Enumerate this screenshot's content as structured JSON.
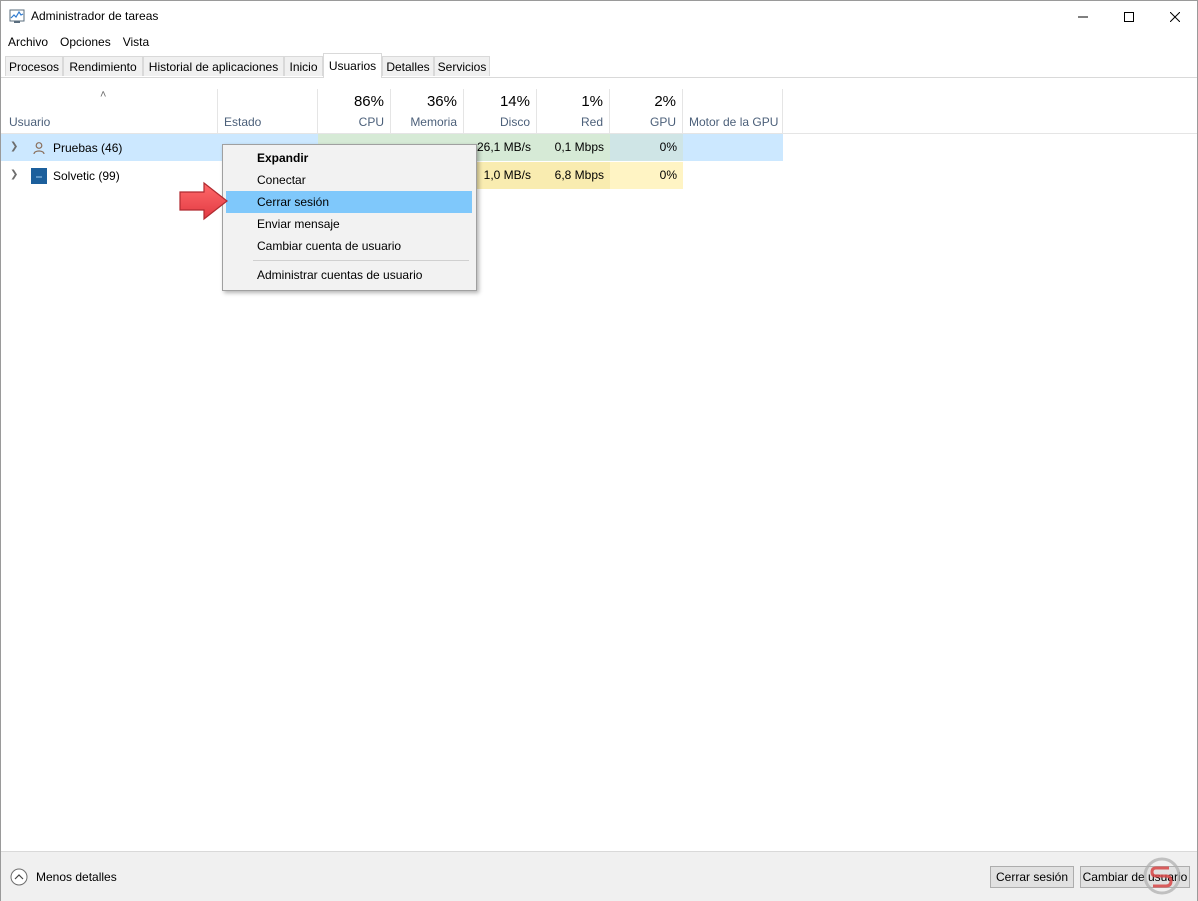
{
  "window": {
    "title": "Administrador de tareas"
  },
  "menu": [
    "Archivo",
    "Opciones",
    "Vista"
  ],
  "tabs": [
    "Procesos",
    "Rendimiento",
    "Historial de aplicaciones",
    "Inicio",
    "Usuarios",
    "Detalles",
    "Servicios"
  ],
  "active_tab": "Usuarios",
  "columns": {
    "usuario": "Usuario",
    "estado": "Estado",
    "cpu": {
      "pct": "86%",
      "label": "CPU"
    },
    "memoria": {
      "pct": "36%",
      "label": "Memoria"
    },
    "disco": {
      "pct": "14%",
      "label": "Disco"
    },
    "red": {
      "pct": "1%",
      "label": "Red"
    },
    "gpu": {
      "pct": "2%",
      "label": "GPU"
    },
    "motor_gpu": "Motor de la GPU"
  },
  "rows": [
    {
      "name": "Pruebas (46)",
      "disco": "26,1 MB/s",
      "red": "0,1 Mbps",
      "gpu": "0%"
    },
    {
      "name": "Solvetic (99)",
      "disco": "1,0 MB/s",
      "red": "6,8 Mbps",
      "gpu": "0%"
    }
  ],
  "context_menu": {
    "items": [
      "Expandir",
      "Conectar",
      "Cerrar sesión",
      "Enviar mensaje",
      "Cambiar cuenta de usuario",
      "Administrar cuentas de usuario"
    ],
    "highlighted": "Cerrar sesión",
    "bold": "Expandir"
  },
  "footer": {
    "less_details": "Menos detalles",
    "logout_button": "Cerrar sesión",
    "switch_button": "Cambiar de usuario"
  },
  "colors": {
    "selection": "#cce8ff",
    "menu_highlight": "#7fc8fb",
    "arrow": "#f0474f"
  },
  "icons": [
    "task-manager-icon",
    "minimize-icon",
    "maximize-icon",
    "close-icon",
    "sort-ascending-icon",
    "chevron-right-icon",
    "user-icon",
    "chevron-up-icon",
    "arrow-annotation-icon"
  ]
}
